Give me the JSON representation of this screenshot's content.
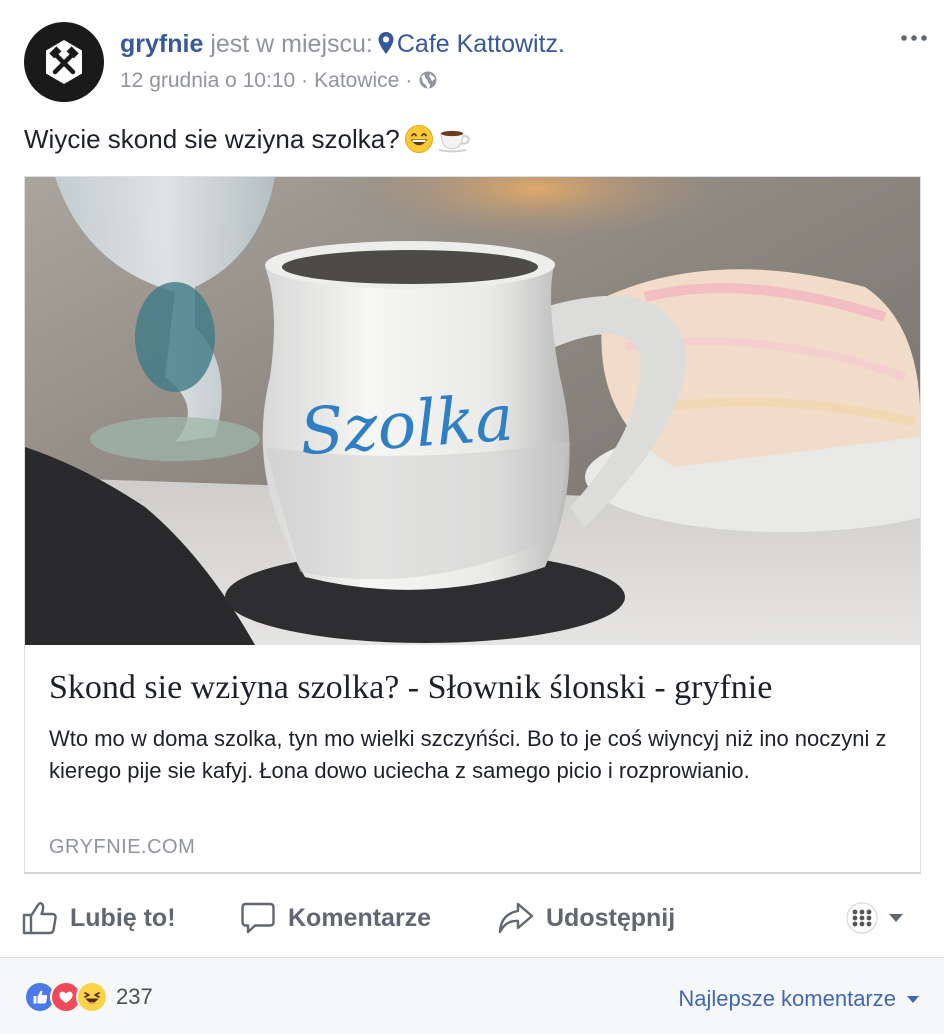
{
  "post": {
    "author": "gryfnie",
    "checkin_text": "jest w miejscu:",
    "place": "Cafe Kattowitz.",
    "date": "12 grudnia o 10:10",
    "location": "Katowice",
    "separator": "·",
    "text": "Wiycie skond sie wziyna szolka?",
    "emojis": [
      "grinning-face-icon",
      "hot-beverage-icon"
    ]
  },
  "link_card": {
    "title": "Skond sie wziyna szolka? - Słownik ślonski - gryfnie",
    "description": "Wto mo w doma szolka, tyn mo wielki szczyńści. Bo to je coś wiyncyj niż ino noczyni z kierego pije sie kafyj. Łona dowo uciecha z samego picio i rozprowianio.",
    "domain": "GRYFNIE.COM",
    "image_mug_text": "Szolka"
  },
  "actions": {
    "like": "Lubię to!",
    "comment": "Komentarze",
    "share": "Udostępnij"
  },
  "footer": {
    "reaction_count": "237",
    "sort_label": "Najlepsze komentarze"
  },
  "colors": {
    "link": "#365899",
    "meta": "#90949c",
    "text": "#1d2129",
    "action": "#606770",
    "like_blue": "#4a7be8",
    "love_red": "#f0495a",
    "haha_yellow": "#fbd34a",
    "sort_link": "#4267b2"
  }
}
